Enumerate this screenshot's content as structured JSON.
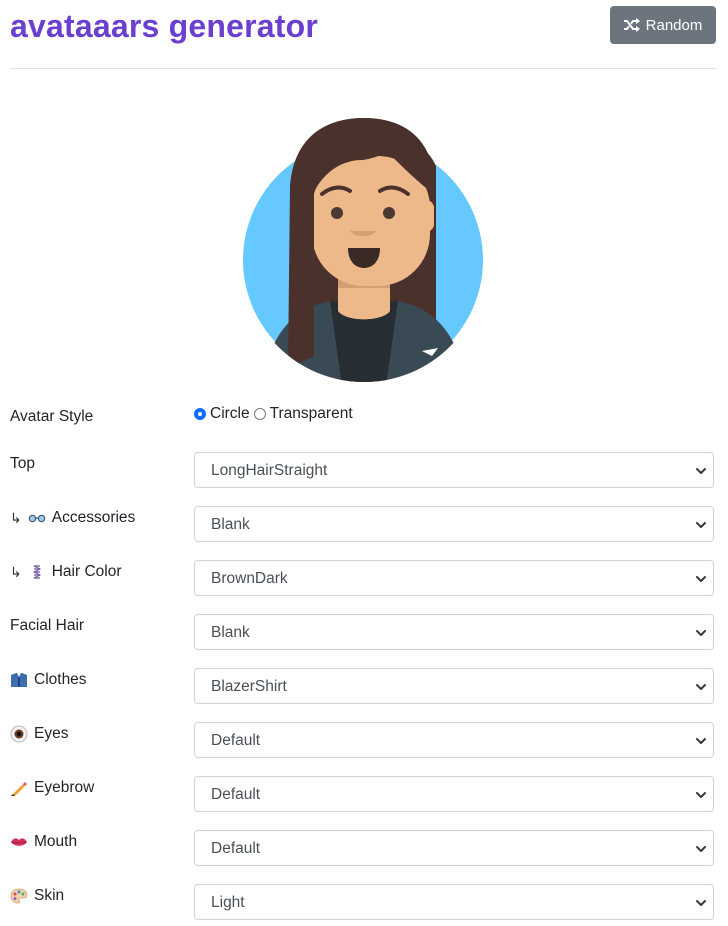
{
  "header": {
    "title": "avataaars generator",
    "random_label": "Random",
    "random_icon": "shuffle-icon"
  },
  "avatar": {
    "background_color": "#65C9FF",
    "skin_color": "#EDB98A",
    "hair_color": "#4A312C",
    "clothes_color": "#262E33"
  },
  "avatar_style": {
    "label": "Avatar Style",
    "options": [
      "Circle",
      "Transparent"
    ],
    "selected": "Circle"
  },
  "fields": [
    {
      "label": "Top",
      "prefix": "",
      "icon": "",
      "value": "LongHairStraight"
    },
    {
      "label": "Accessories",
      "prefix": "↳",
      "icon": "glasses-icon",
      "glyph": "👓",
      "value": "Blank"
    },
    {
      "label": "Hair Color",
      "prefix": "↳",
      "icon": "hair-spring-icon",
      "glyph": "✂",
      "value": "BrownDark"
    },
    {
      "label": "Facial Hair",
      "prefix": "",
      "icon": "",
      "value": "Blank"
    },
    {
      "label": "Clothes",
      "prefix": "",
      "icon": "shirt-icon",
      "glyph": "👔",
      "value": "BlazerShirt"
    },
    {
      "label": "Eyes",
      "prefix": "",
      "icon": "eye-icon",
      "glyph": "◉",
      "value": "Default"
    },
    {
      "label": "Eyebrow",
      "prefix": "",
      "icon": "pencil-icon",
      "glyph": "✏",
      "value": "Default"
    },
    {
      "label": "Mouth",
      "prefix": "",
      "icon": "lips-icon",
      "glyph": "👄",
      "value": "Default"
    },
    {
      "label": "Skin",
      "prefix": "",
      "icon": "palette-icon",
      "glyph": "🎨",
      "value": "Light"
    }
  ]
}
